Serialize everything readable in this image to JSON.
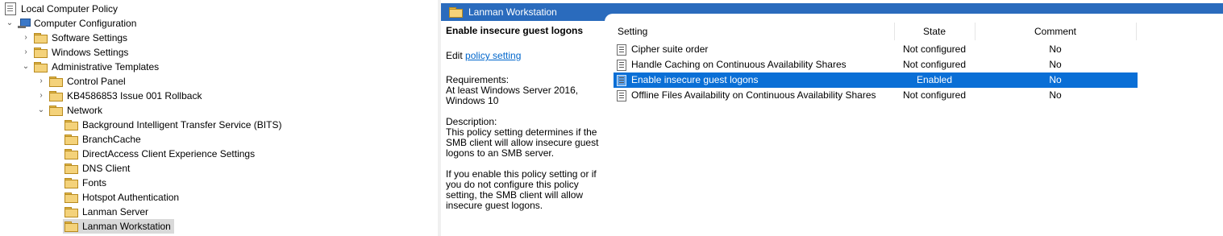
{
  "tree": {
    "root": "Local Computer Policy",
    "computer_config": "Computer Configuration",
    "software_settings": "Software Settings",
    "windows_settings": "Windows Settings",
    "admin_templates": "Administrative Templates",
    "control_panel": "Control Panel",
    "kb_rollback": "KB4586853 Issue 001 Rollback",
    "network": "Network",
    "network_children": [
      "Background Intelligent Transfer Service (BITS)",
      "BranchCache",
      "DirectAccess Client Experience Settings",
      "DNS Client",
      "Fonts",
      "Hotspot Authentication",
      "Lanman Server",
      "Lanman Workstation"
    ]
  },
  "header": {
    "title": "Lanman Workstation"
  },
  "description": {
    "title": "Enable insecure guest logons",
    "edit_prefix": "Edit ",
    "edit_link": "policy setting",
    "requirements_label": "Requirements:",
    "requirements_line1": "At least Windows Server 2016,",
    "requirements_line2": "Windows 10",
    "description_label": "Description:",
    "p1_line1": "This policy setting determines if the",
    "p1_line2": "SMB client will allow insecure guest",
    "p1_line3": "logons to an SMB server.",
    "p2_line1": "If you enable this policy setting or if",
    "p2_line2": "you do not configure this policy",
    "p2_line3": "setting, the SMB client will allow",
    "p2_line4": "insecure guest logons."
  },
  "list": {
    "columns": {
      "setting": "Setting",
      "state": "State",
      "comment": "Comment"
    },
    "rows": [
      {
        "setting": "Cipher suite order",
        "state": "Not configured",
        "comment": "No"
      },
      {
        "setting": "Handle Caching on Continuous Availability Shares",
        "state": "Not configured",
        "comment": "No"
      },
      {
        "setting": "Enable insecure guest logons",
        "state": "Enabled",
        "comment": "No"
      },
      {
        "setting": "Offline Files Availability on Continuous Availability Shares",
        "state": "Not configured",
        "comment": "No"
      }
    ]
  },
  "colors": {
    "header_bg": "#2a6bbd",
    "selection": "#0a6fd6",
    "link": "#0066cc"
  }
}
